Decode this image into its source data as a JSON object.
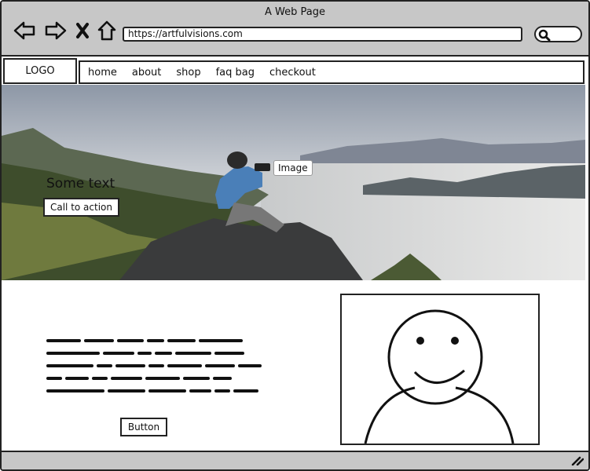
{
  "window": {
    "title": "A Web Page"
  },
  "browser": {
    "url": "https://artfulvisions.com",
    "back_icon": "back-arrow-icon",
    "forward_icon": "forward-arrow-icon",
    "close_icon": "close-x-icon",
    "home_icon": "home-icon",
    "search_icon": "search-icon"
  },
  "site": {
    "logo": "LOGO",
    "nav": [
      {
        "label": "home"
      },
      {
        "label": "about"
      },
      {
        "label": "shop"
      },
      {
        "label": "faq bag"
      },
      {
        "label": "checkout"
      }
    ]
  },
  "hero": {
    "image_label": "Image",
    "text": "Some text",
    "cta_label": "Call to action"
  },
  "content": {
    "button_label": "Button",
    "placeholder_image": "smiley-avatar-icon"
  },
  "colors": {
    "chrome": "#c7c7c7",
    "stroke": "#222222"
  }
}
